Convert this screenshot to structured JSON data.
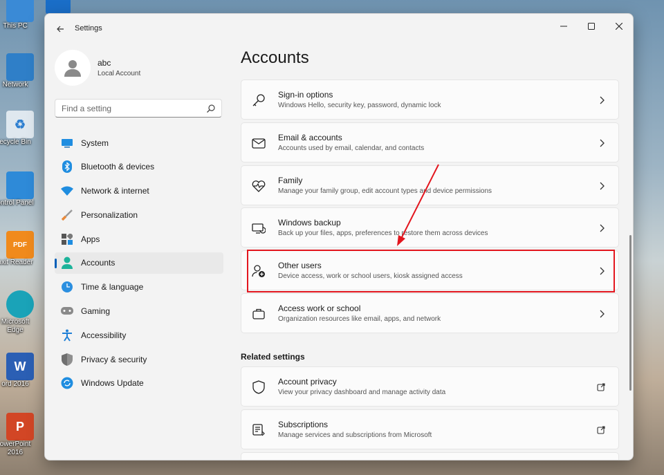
{
  "desktop": {
    "icons": [
      {
        "label": "This PC"
      },
      {
        "label": "Network"
      },
      {
        "label": "ecycle Bin"
      },
      {
        "label": "ontrol Panel"
      },
      {
        "label": "oxit Reader"
      },
      {
        "label": "Microsoft"
      },
      {
        "label": "Edge"
      },
      {
        "label": "ord 2016"
      },
      {
        "label": "owerPoint"
      },
      {
        "label": "2016"
      }
    ]
  },
  "window": {
    "title": "Settings"
  },
  "profile": {
    "name": "abc",
    "account_type": "Local Account"
  },
  "search": {
    "placeholder": "Find a setting"
  },
  "nav": {
    "items": [
      {
        "label": "System",
        "icon": "monitor-icon"
      },
      {
        "label": "Bluetooth & devices",
        "icon": "bluetooth-icon"
      },
      {
        "label": "Network & internet",
        "icon": "wifi-icon"
      },
      {
        "label": "Personalization",
        "icon": "brush-icon"
      },
      {
        "label": "Apps",
        "icon": "apps-icon"
      },
      {
        "label": "Accounts",
        "icon": "person-icon",
        "active": true
      },
      {
        "label": "Time & language",
        "icon": "clock-globe-icon"
      },
      {
        "label": "Gaming",
        "icon": "gamepad-icon"
      },
      {
        "label": "Accessibility",
        "icon": "accessibility-icon"
      },
      {
        "label": "Privacy & security",
        "icon": "shield-icon"
      },
      {
        "label": "Windows Update",
        "icon": "sync-icon"
      }
    ]
  },
  "main": {
    "title": "Accounts",
    "cards": [
      {
        "title": "Sign-in options",
        "subtitle": "Windows Hello, security key, password, dynamic lock",
        "icon": "key-icon"
      },
      {
        "title": "Email & accounts",
        "subtitle": "Accounts used by email, calendar, and contacts",
        "icon": "mail-icon"
      },
      {
        "title": "Family",
        "subtitle": "Manage your family group, edit account types and device permissions",
        "icon": "heart-icon"
      },
      {
        "title": "Windows backup",
        "subtitle": "Back up your files, apps, preferences to restore them across devices",
        "icon": "backup-icon"
      },
      {
        "title": "Other users",
        "subtitle": "Device access, work or school users, kiosk assigned access",
        "icon": "add-user-icon"
      },
      {
        "title": "Access work or school",
        "subtitle": "Organization resources like email, apps, and network",
        "icon": "briefcase-icon"
      }
    ],
    "related_title": "Related settings",
    "related": [
      {
        "title": "Account privacy",
        "subtitle": "View your privacy dashboard and manage activity data",
        "icon": "shield-outline-icon"
      },
      {
        "title": "Subscriptions",
        "subtitle": "Manage services and subscriptions from Microsoft",
        "icon": "subscriptions-icon"
      }
    ]
  },
  "annotation": {
    "color": "#e3161e",
    "highlighted_item": "Other users"
  },
  "colors": {
    "accent": "#005fb8"
  }
}
